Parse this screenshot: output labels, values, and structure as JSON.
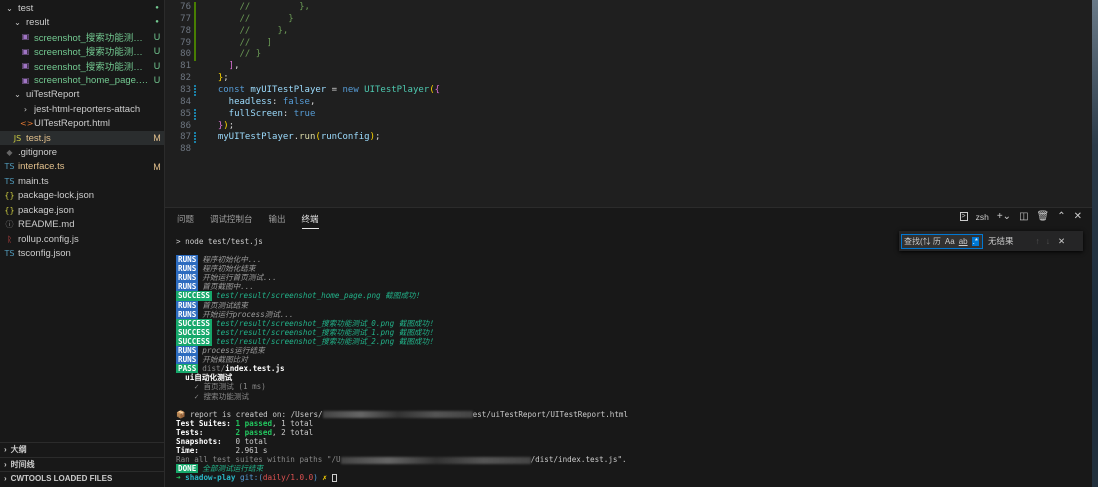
{
  "sidebar": {
    "items": [
      {
        "label": "test",
        "indent": 0,
        "icon": "chevron-down",
        "dot": true
      },
      {
        "label": "result",
        "indent": 1,
        "icon": "chevron-down",
        "dot": true
      },
      {
        "label": "screenshot_搜索功能测试_0...",
        "indent": 2,
        "icon": "image",
        "badge": "U",
        "color": "green"
      },
      {
        "label": "screenshot_搜索功能测试_1....",
        "indent": 2,
        "icon": "image",
        "badge": "U",
        "color": "green"
      },
      {
        "label": "screenshot_搜索功能测试_2...",
        "indent": 2,
        "icon": "image",
        "badge": "U",
        "color": "green"
      },
      {
        "label": "screenshot_home_page.png",
        "indent": 2,
        "icon": "image",
        "badge": "U",
        "color": "green"
      },
      {
        "label": "uiTestReport",
        "indent": 1,
        "icon": "chevron-down"
      },
      {
        "label": "jest-html-reporters-attach",
        "indent": 2,
        "icon": "chevron-right"
      },
      {
        "label": "UITestReport.html",
        "indent": 2,
        "icon": "html"
      },
      {
        "label": "test.js",
        "indent": 1,
        "icon": "js",
        "badge": "M",
        "color": "gold",
        "selected": true
      },
      {
        "label": ".gitignore",
        "indent": 0,
        "icon": "git"
      },
      {
        "label": "interface.ts",
        "indent": 0,
        "icon": "ts",
        "badge": "M",
        "color": "gold"
      },
      {
        "label": "main.ts",
        "indent": 0,
        "icon": "ts"
      },
      {
        "label": "package-lock.json",
        "indent": 0,
        "icon": "json"
      },
      {
        "label": "package.json",
        "indent": 0,
        "icon": "json"
      },
      {
        "label": "README.md",
        "indent": 0,
        "icon": "info"
      },
      {
        "label": "rollup.config.js",
        "indent": 0,
        "icon": "rollup"
      },
      {
        "label": "tsconfig.json",
        "indent": 0,
        "icon": "tsconfig"
      }
    ],
    "sections": [
      "大纲",
      "时间线",
      "CWTOOLS LOADED FILES"
    ]
  },
  "editor": {
    "lines": [
      {
        "n": "76",
        "g": "mod",
        "t": [
          [
            "      //         },",
            "c"
          ]
        ]
      },
      {
        "n": "77",
        "g": "mod",
        "t": [
          [
            "      //       }",
            "c"
          ]
        ]
      },
      {
        "n": "78",
        "g": "mod",
        "t": [
          [
            "      //     },",
            "c"
          ]
        ]
      },
      {
        "n": "79",
        "g": "mod",
        "t": [
          [
            "      //   ]",
            "c"
          ]
        ]
      },
      {
        "n": "80",
        "g": "mod",
        "t": [
          [
            "      // }",
            "c"
          ]
        ]
      },
      {
        "n": "81",
        "t": [
          [
            "    ]",
            "p"
          ],
          [
            ",",
            "w"
          ]
        ]
      },
      {
        "n": "82",
        "t": [
          [
            "  }",
            "y"
          ],
          [
            ";",
            "w"
          ]
        ]
      },
      {
        "n": "83",
        "g": "add",
        "t": [
          [
            "  const ",
            "k"
          ],
          [
            "myUITestPlayer",
            "v"
          ],
          [
            " = ",
            "w"
          ],
          [
            "new ",
            "k"
          ],
          [
            "UITestPlayer",
            "t"
          ],
          [
            "(",
            "y"
          ],
          [
            "{",
            "p"
          ]
        ]
      },
      {
        "n": "84",
        "t": [
          [
            "    headless",
            "v"
          ],
          [
            ": ",
            "w"
          ],
          [
            "false",
            "k"
          ],
          [
            ",",
            "w"
          ]
        ]
      },
      {
        "n": "85",
        "g": "add",
        "t": [
          [
            "    fullScreen",
            "v"
          ],
          [
            ": ",
            "w"
          ],
          [
            "true",
            "k"
          ]
        ]
      },
      {
        "n": "86",
        "t": [
          [
            "  }",
            "p"
          ],
          [
            ")",
            "y"
          ],
          [
            ";",
            "w"
          ]
        ]
      },
      {
        "n": "87",
        "g": "add",
        "t": [
          [
            "  myUITestPlayer",
            "v"
          ],
          [
            ".",
            "w"
          ],
          [
            "run",
            "f"
          ],
          [
            "(",
            "y"
          ],
          [
            "runConfig",
            "v"
          ],
          [
            ")",
            "y"
          ],
          [
            ";",
            "w"
          ]
        ]
      },
      {
        "n": "88",
        "t": []
      }
    ]
  },
  "panel": {
    "tabs": [
      "问题",
      "调试控制台",
      "输出",
      "终端"
    ],
    "active_tab": 3,
    "shell": "zsh",
    "find": {
      "placeholder": "查找(⇅ 历",
      "opt_case": "Aa",
      "opt_word": "ab",
      "opt_regex": ".*",
      "result": "无结果"
    }
  },
  "terminal": {
    "command": "> node test/test.js",
    "log": [
      {
        "tag": "RUNS",
        "msg": "程序初始化中..."
      },
      {
        "tag": "RUNS",
        "msg": "程序初始化结束"
      },
      {
        "tag": "RUNS",
        "msg": "开始运行首页测试..."
      },
      {
        "tag": "RUNS",
        "msg": "首页截图中..."
      },
      {
        "tag": "SUCCESS",
        "msg": "test/result/screenshot_home_page.png 截图成功！"
      },
      {
        "tag": "RUNS",
        "msg": "首页测试结束"
      },
      {
        "tag": "RUNS",
        "msg": "开始运行process测试..."
      },
      {
        "tag": "SUCCESS",
        "msg": "test/result/screenshot_搜索功能测试_0.png 截图成功！"
      },
      {
        "tag": "SUCCESS",
        "msg": "test/result/screenshot_搜索功能测试_1.png 截图成功！"
      },
      {
        "tag": "SUCCESS",
        "msg": "test/result/screenshot_搜索功能测试_2.png 截图成功！"
      },
      {
        "tag": "RUNS",
        "msg": "process运行结束"
      },
      {
        "tag": "RUNS",
        "msg": "开始截图比对"
      }
    ],
    "pass_tag": "PASS",
    "pass_dir": "dist/",
    "pass_file": "index.test.js",
    "suite": "ui自动化测试",
    "tests": [
      "✓ 首页测试 (1 ms)",
      "✓ 搜索功能测试"
    ],
    "report_prefix": "📦 report is created on: /Users/",
    "report_suffix": "est/uiTestReport/UITestReport.html",
    "summary": [
      {
        "label": "Test Suites: ",
        "passed": "1 passed",
        "rest": ", 1 total"
      },
      {
        "label": "Tests:       ",
        "passed": "2 passed",
        "rest": ", 2 total"
      },
      {
        "label": "Snapshots:   ",
        "passed": "",
        "rest": "0 total"
      },
      {
        "label": "Time:        ",
        "passed": "",
        "rest": "2.961 s"
      }
    ],
    "ran_prefix": "Ran all test suites within paths \"/U",
    "ran_suffix": "/dist/index.test.js\".",
    "done_tag": "DONE",
    "done_msg": "全部测试运行结束",
    "prompt_arrow": "➜",
    "prompt_dir": "shadow-play",
    "prompt_git": "git:(",
    "prompt_branch": "daily/1.0.0",
    "prompt_close": ")",
    "prompt_x": "✗"
  }
}
